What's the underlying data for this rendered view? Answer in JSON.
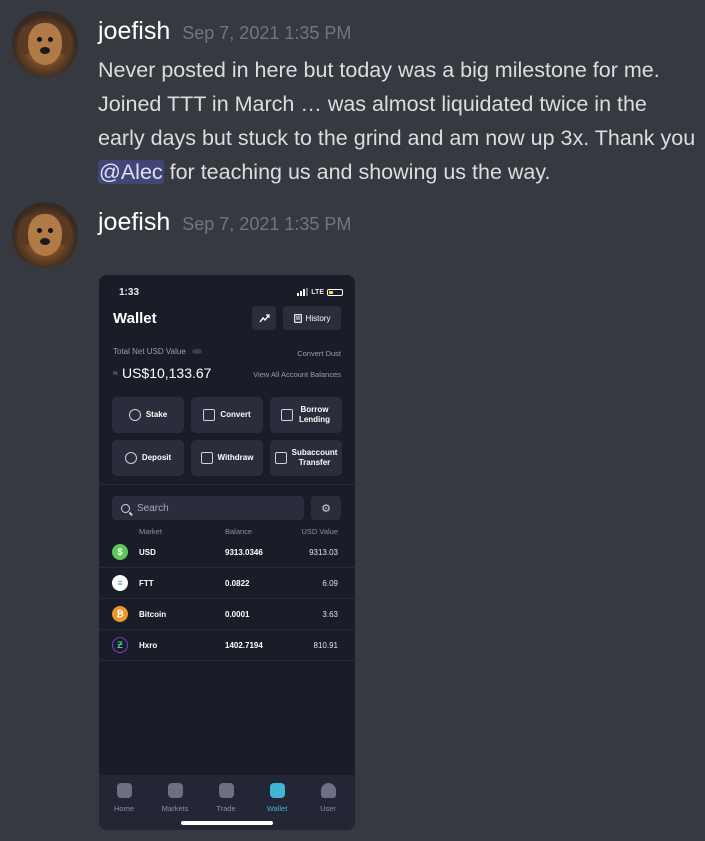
{
  "messages": [
    {
      "username": "joefish",
      "timestamp": "Sep 7, 2021 1:35 PM",
      "text_before": "Never posted in here but today was a big milestone for me. Joined TTT in March … was almost liquidated twice in the early days but stuck to the grind and am now up 3x. Thank you ",
      "mention": "@Alec",
      "text_after": " for teaching us and showing us the way."
    },
    {
      "username": "joefish",
      "timestamp": "Sep 7, 2021 1:35 PM"
    }
  ],
  "phone": {
    "time": "1:33",
    "network": "LTE",
    "title": "Wallet",
    "history_label": "History",
    "total_label": "Total Net USD Value",
    "convert_dust": "Convert Dust",
    "balance_prefix": "≈",
    "balance": "US$10,133.67",
    "view_all": "View All Account Balances",
    "actions": [
      {
        "label": "Stake",
        "icon": "stake-icon"
      },
      {
        "label": "Convert",
        "icon": "convert-icon"
      },
      {
        "label": "Borrow Lending",
        "icon": "borrow-icon"
      },
      {
        "label": "Deposit",
        "icon": "deposit-icon"
      },
      {
        "label": "Withdraw",
        "icon": "withdraw-icon"
      },
      {
        "label": "Subaccount Transfer",
        "icon": "transfer-icon"
      }
    ],
    "search_placeholder": "Search",
    "table_headers": {
      "market": "Market",
      "balance": "Balance",
      "usd": "USD Value"
    },
    "rows": [
      {
        "market": "USD",
        "balance": "9313.0346",
        "usd": "9313.03",
        "color": "#5cc95a",
        "glyph": "$"
      },
      {
        "market": "FTT",
        "balance": "0.0822",
        "usd": "6.09",
        "color": "#ffffff",
        "glyph": "≡"
      },
      {
        "market": "Bitcoin",
        "balance": "0.0001",
        "usd": "3.63",
        "color": "#f0962f",
        "glyph": "₿"
      },
      {
        "market": "Hxro",
        "balance": "1402.7194",
        "usd": "810.91",
        "color": "#1a1c27",
        "glyph": "Ƶ"
      }
    ],
    "tabs": [
      {
        "label": "Home",
        "icon": "home-icon"
      },
      {
        "label": "Markets",
        "icon": "markets-icon"
      },
      {
        "label": "Trade",
        "icon": "trade-icon"
      },
      {
        "label": "Wallet",
        "icon": "wallet-icon",
        "active": true
      },
      {
        "label": "User",
        "icon": "user-icon"
      }
    ]
  }
}
